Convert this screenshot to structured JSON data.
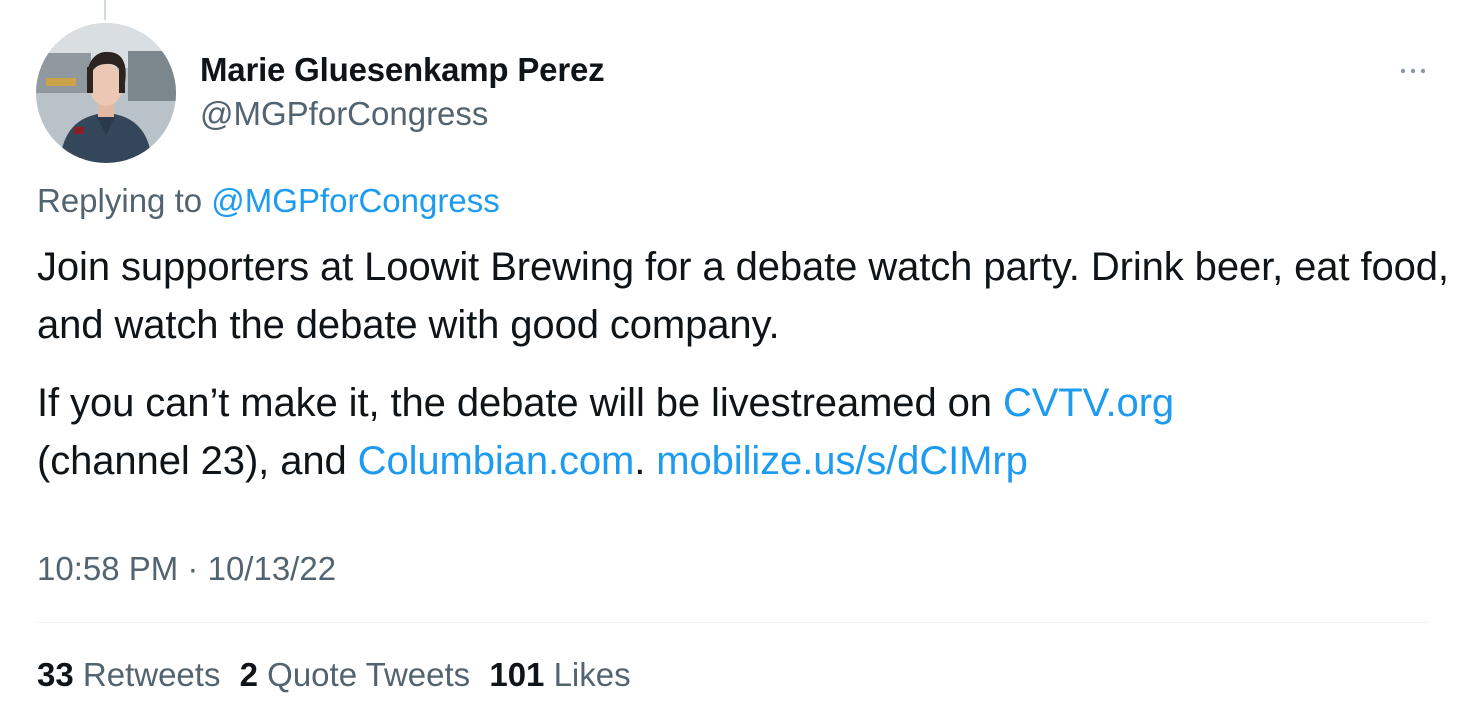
{
  "author": {
    "name": "Marie Gluesenkamp Perez",
    "handle": "@MGPforCongress"
  },
  "reply": {
    "prefix": "Replying to",
    "to_handle": "@MGPforCongress"
  },
  "tweet": {
    "p1": "Join supporters at Loowit Brewing for a debate watch party. Drink beer, eat food, and watch the debate with good company.",
    "p2_start": "If you can’t make it, the debate will be livestreamed on",
    "link_cvtv": "CVTV.org",
    "p2_mid": "(channel 23), and",
    "link_columbian": "Columbian.com",
    "p2_end": ".",
    "link_mobilize": "mobilize.us/s/dCIMrp"
  },
  "meta": {
    "time": "10:58 PM",
    "separator": "·",
    "date": "10/13/22"
  },
  "stats": {
    "retweets_count": "33",
    "retweets_label": "Retweets",
    "quotes_count": "2",
    "quotes_label": "Quote Tweets",
    "likes_count": "101",
    "likes_label": "Likes"
  },
  "colors": {
    "text": "#0f1419",
    "secondary": "#536471",
    "link": "#1d9bf0",
    "divider": "#eff3f4"
  },
  "icons": {
    "more": "more-horizontal-icon"
  }
}
